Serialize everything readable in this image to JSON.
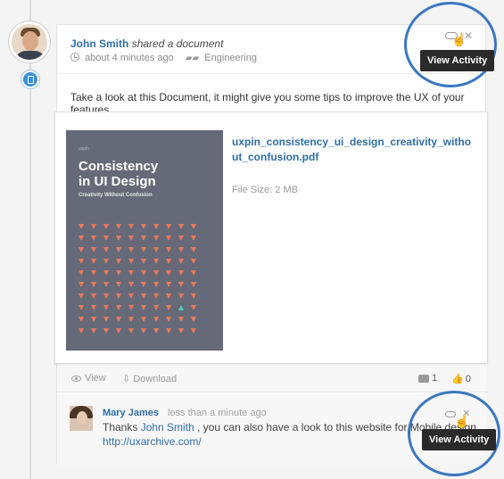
{
  "post": {
    "author": "John Smith",
    "action": "shared a document",
    "time": "about 4 minutes ago",
    "team": "Engineering",
    "message": "Take a look at this Document, it might give you some tips to improve the UX of your features.",
    "tooltip": "View Activity"
  },
  "document": {
    "cover_tiny": "uxpin",
    "cover_title_line1": "Consistency",
    "cover_title_line2": "in UI Design",
    "cover_subtitle": "Creativity Without Confusion",
    "file_name": "uxpin_consistency_ui_design_creativity_without_confusion.pdf",
    "file_size": "File Size:  2 MB"
  },
  "actions": {
    "view": "View",
    "download": "Download",
    "comments": "1",
    "likes": "0"
  },
  "comment": {
    "author": "Mary James",
    "time": "less than a minute ago",
    "text_before": "Thanks ",
    "mention": "John Smith",
    "text_after": " , you can also have a look to this website for Mobile design",
    "link": "http://uxarchive.com/",
    "tooltip": "View Activity"
  },
  "colors": {
    "accent": "#2f6ea5",
    "badge": "#3d8fd6",
    "cover": "#666a78",
    "triangle": "#e87a5e",
    "triangle_highlight": "#4ad0c0",
    "highlight_circle": "#3a77c0"
  }
}
